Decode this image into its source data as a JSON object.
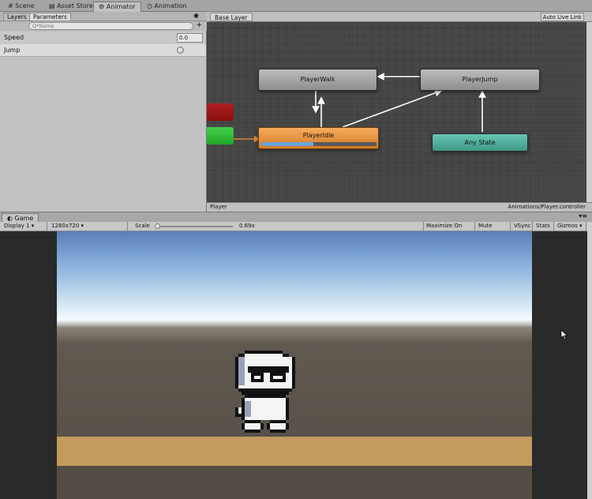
{
  "top_tabs": [
    {
      "label": "Scene",
      "icon": "scene-icon"
    },
    {
      "label": "Asset Store",
      "icon": "store-icon"
    },
    {
      "label": "Animator",
      "icon": "animator-icon",
      "active": true
    },
    {
      "label": "Animation",
      "icon": "clock-icon"
    }
  ],
  "left_panel": {
    "tabs": [
      "Layers",
      "Parameters"
    ],
    "search_placeholder": "Q*Name",
    "params": [
      {
        "name": "Speed",
        "type": "float",
        "value": "0.0"
      },
      {
        "name": "Jump",
        "type": "bool",
        "value": false
      }
    ]
  },
  "graph": {
    "breadcrumb": "Base Layer",
    "auto_live_link": "Auto Live Link",
    "states": {
      "player_walk": "PlayerWalk",
      "player_jump": "PlayerJump",
      "player_idle": "PlayerIdle",
      "any_state": "Any State"
    },
    "player_idle_progress": 0.45,
    "footer_left": "Player",
    "footer_right": "Animations/Player.controller",
    "colors": {
      "entry": "#33c13a",
      "exit": "#a51616",
      "default_state": "#e8922f",
      "any_state": "#52b39f"
    }
  },
  "game": {
    "tab_label": "Game",
    "toolbar": {
      "display": "Display 1",
      "resolution": "1280x720",
      "scale_label": "Scale",
      "scale_value": "0.69",
      "maximize": "Maximize On Play",
      "mute": "Mute Audio",
      "vsync": "VSync",
      "stats": "Stats",
      "gizmos": "Gizmos"
    }
  }
}
